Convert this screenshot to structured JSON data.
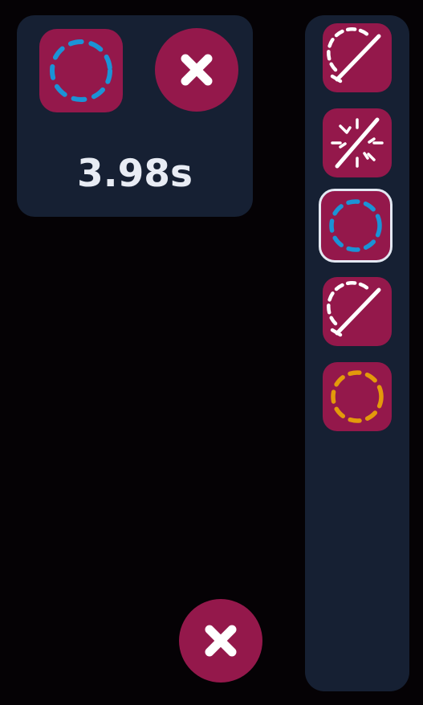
{
  "panel": {
    "timer": "3.98s",
    "icons": {
      "current_tool": "dashed-circle-icon",
      "close": "close-icon"
    }
  },
  "sidebar": {
    "tools": [
      {
        "icon": "dashed-arc-slash-icon",
        "selected": false
      },
      {
        "icon": "burst-slash-icon",
        "selected": false
      },
      {
        "icon": "dashed-circle-icon",
        "color": "#1b93d6",
        "selected": true
      },
      {
        "icon": "dashed-arc-slash-icon",
        "selected": false
      },
      {
        "icon": "dashed-circle-icon",
        "color": "#e39a0b",
        "selected": false
      }
    ]
  },
  "footer": {
    "icons": {
      "close": "close-icon"
    }
  },
  "colors": {
    "background": "#050205",
    "panel": "#162033",
    "button": "#94184b",
    "text": "#e8ecf4",
    "blue": "#1b93d6",
    "orange": "#e39a0b"
  }
}
